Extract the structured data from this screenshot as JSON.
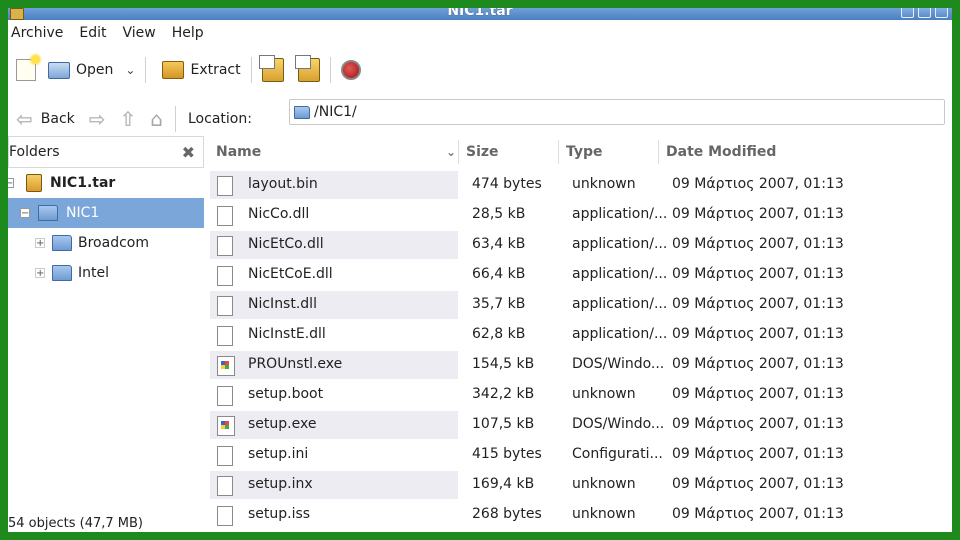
{
  "window": {
    "title": "NIC1.tar"
  },
  "menu": [
    "Archive",
    "Edit",
    "View",
    "Help"
  ],
  "toolbar": {
    "open_label": "Open",
    "extract_label": "Extract"
  },
  "nav": {
    "back_label": "Back",
    "location_label": "Location:",
    "location_value": "/NIC1/"
  },
  "sidebar": {
    "header": "Folders",
    "tree": [
      {
        "label": "NIC1.tar",
        "expander": "−"
      },
      {
        "label": "NIC1",
        "expander": "−"
      },
      {
        "label": "Broadcom",
        "expander": "+"
      },
      {
        "label": "Intel",
        "expander": "+"
      }
    ]
  },
  "columns": {
    "name": "Name",
    "size": "Size",
    "type": "Type",
    "date": "Date Modified"
  },
  "files": [
    {
      "name": "layout.bin",
      "size": "474 bytes",
      "type": "unknown",
      "date": "09 Μάρτιος 2007, 01:13",
      "icon": "file-icon"
    },
    {
      "name": "NicCo.dll",
      "size": "28,5 kB",
      "type": "application/...",
      "date": "09 Μάρτιος 2007, 01:13",
      "icon": "file-icon"
    },
    {
      "name": "NicEtCo.dll",
      "size": "63,4 kB",
      "type": "application/...",
      "date": "09 Μάρτιος 2007, 01:13",
      "icon": "file-icon"
    },
    {
      "name": "NicEtCoE.dll",
      "size": "66,4 kB",
      "type": "application/...",
      "date": "09 Μάρτιος 2007, 01:13",
      "icon": "file-icon"
    },
    {
      "name": "NicInst.dll",
      "size": "35,7 kB",
      "type": "application/...",
      "date": "09 Μάρτιος 2007, 01:13",
      "icon": "file-icon"
    },
    {
      "name": "NicInstE.dll",
      "size": "62,8 kB",
      "type": "application/...",
      "date": "09 Μάρτιος 2007, 01:13",
      "icon": "file-icon"
    },
    {
      "name": "PROUnstl.exe",
      "size": "154,5 kB",
      "type": "DOS/Windo...",
      "date": "09 Μάρτιος 2007, 01:13",
      "icon": "exe-icon"
    },
    {
      "name": "setup.boot",
      "size": "342,2 kB",
      "type": "unknown",
      "date": "09 Μάρτιος 2007, 01:13",
      "icon": "file-icon"
    },
    {
      "name": "setup.exe",
      "size": "107,5 kB",
      "type": "DOS/Windo...",
      "date": "09 Μάρτιος 2007, 01:13",
      "icon": "exe-icon"
    },
    {
      "name": "setup.ini",
      "size": "415 bytes",
      "type": "Configurati...",
      "date": "09 Μάρτιος 2007, 01:13",
      "icon": "file-icon"
    },
    {
      "name": "setup.inx",
      "size": "169,4 kB",
      "type": "unknown",
      "date": "09 Μάρτιος 2007, 01:13",
      "icon": "file-icon"
    },
    {
      "name": "setup.iss",
      "size": "268 bytes",
      "type": "unknown",
      "date": "09 Μάρτιος 2007, 01:13",
      "icon": "file-icon"
    }
  ],
  "status": "54 objects (47,7 MB)"
}
